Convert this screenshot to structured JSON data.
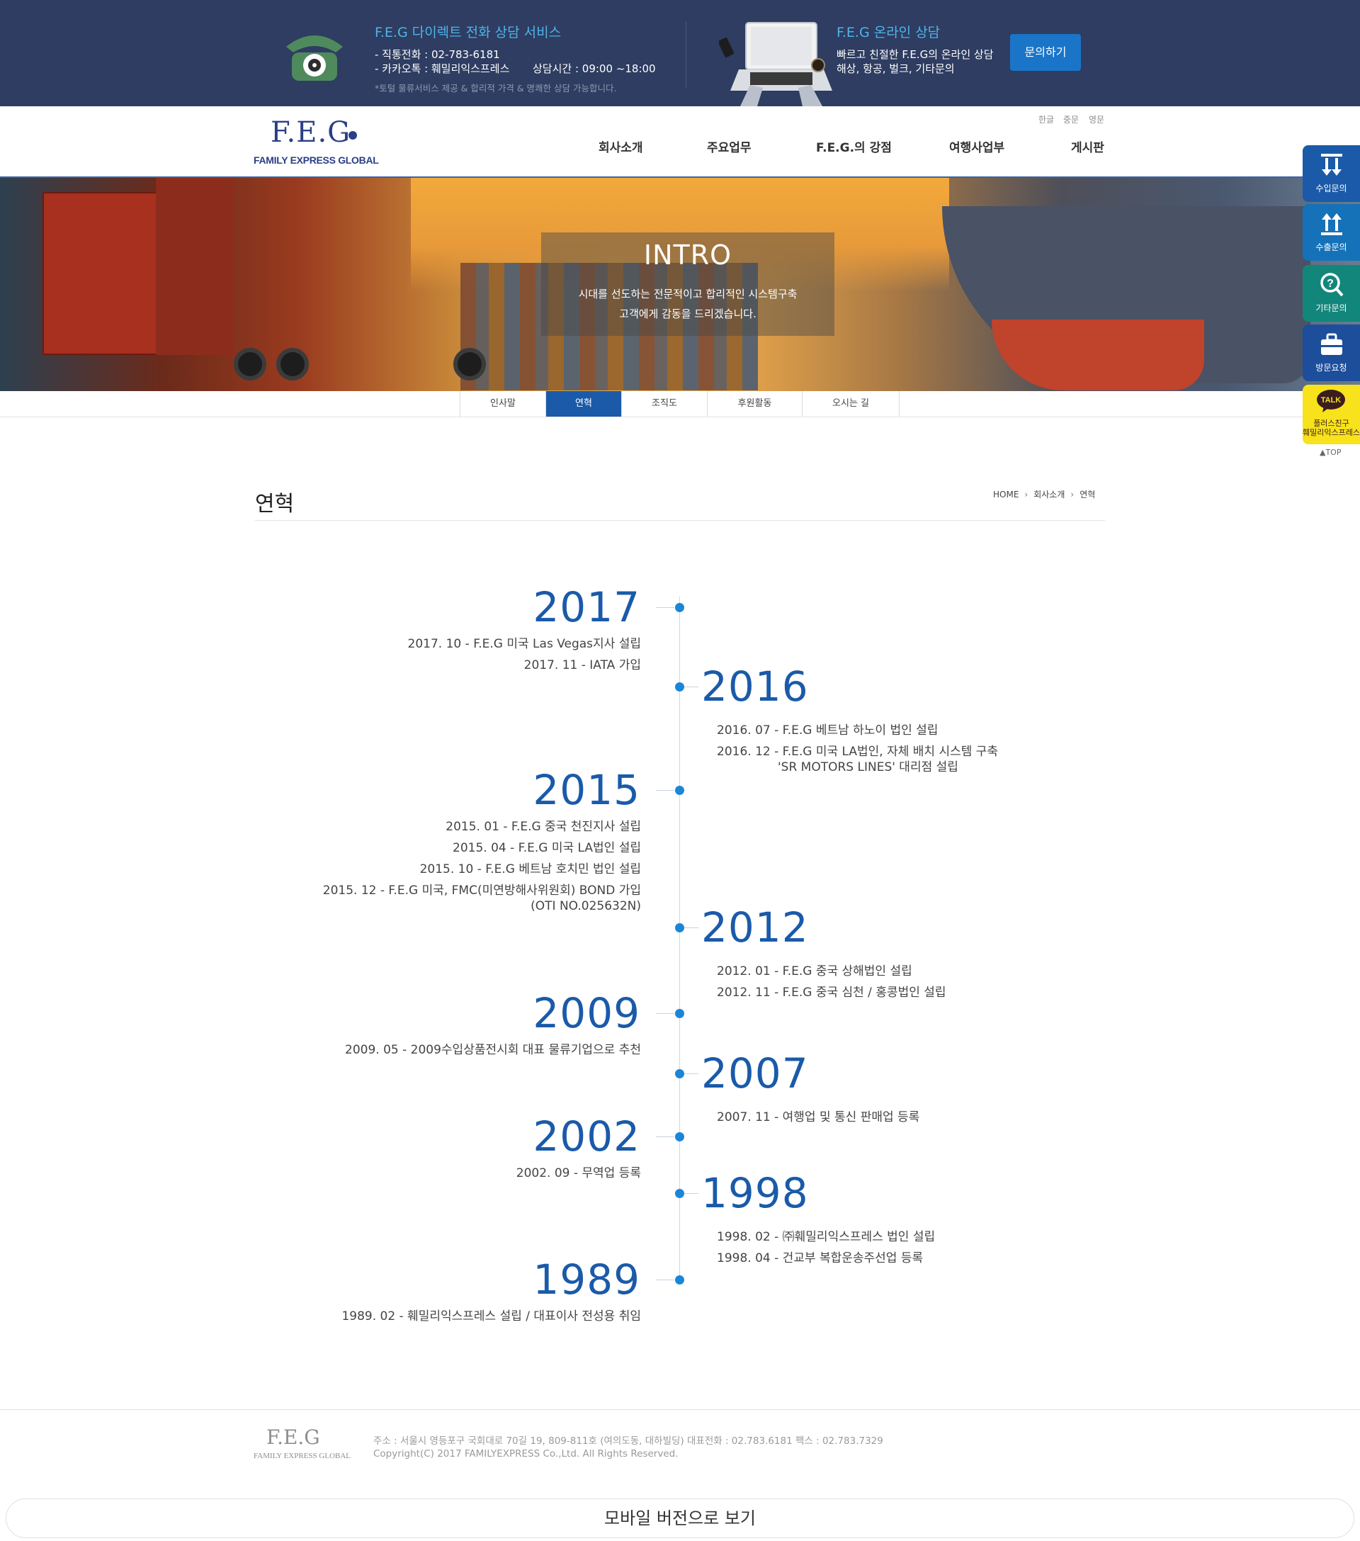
{
  "topbar": {
    "phone_title": "F.E.G 다이렉트 전화 상담 서비스",
    "phone_line1": "- 직통전화 : 02-783-6181",
    "phone_line2": "- 카카오톡 : 훼밀리익스프레스",
    "phone_hours": "상담시간 : 09:00 ~18:00",
    "phone_note": "*토털 물류서비스 제공 & 합리적 가격 & 명쾌한 상담 가능합니다.",
    "online_title": "F.E.G 온라인 상담",
    "online_line1": "빠르고 친절한 F.E.G의 온라인 상담",
    "online_line2": "해상, 항공, 벌크, 기타문의",
    "ask_button": "문의하기"
  },
  "header": {
    "logo_text": "F.E.G",
    "logo_sub": "FAMILY EXPRESS GLOBAL",
    "languages": [
      "한글",
      "중문",
      "영문"
    ],
    "nav": [
      "회사소개",
      "주요업무",
      "F.E.G.의 강점",
      "여행사업부",
      "게시판"
    ]
  },
  "hero": {
    "title": "INTRO",
    "line1": "시대를 선도하는 전문적이고 합리적인 시스템구축",
    "line2": "고객에게 감동을 드리겠습니다."
  },
  "subnav": {
    "items": [
      "인사말",
      "연혁",
      "조직도",
      "후원활동",
      "오시는 길"
    ],
    "active": "연혁"
  },
  "page": {
    "title": "연혁",
    "breadcrumb": [
      "HOME",
      "회사소개",
      "연혁"
    ]
  },
  "timeline": [
    {
      "year": "2017",
      "side": "left",
      "events": [
        "2017. 10 - F.E.G 미국 Las Vegas지사 설립",
        "2017. 11 - IATA 가입"
      ]
    },
    {
      "year": "2016",
      "side": "right",
      "events": [
        "2016. 07 - F.E.G 베트남 하노이 법인 설립",
        "2016. 12 - F.E.G 미국 LA법인, 자체 배치 시스템 구축",
        "'SR MOTORS LINES' 대리점 설립"
      ]
    },
    {
      "year": "2015",
      "side": "left",
      "events": [
        "2015. 01 - F.E.G 중국 천진지사 설립",
        "2015. 04 - F.E.G 미국 LA법인 설립",
        "2015. 10 - F.E.G 베트남 호치민 법인 설립",
        "2015. 12 - F.E.G 미국, FMC(미연방해사위원회) BOND 가입",
        "(OTI NO.025632N)"
      ]
    },
    {
      "year": "2012",
      "side": "right",
      "events": [
        "2012. 01 - F.E.G 중국 상해법인 설립",
        "2012. 11 - F.E.G 중국 심천 / 홍콩법인 설립"
      ]
    },
    {
      "year": "2009",
      "side": "left",
      "events": [
        "2009. 05 - 2009수입상품전시회 대표 물류기업으로 추천"
      ]
    },
    {
      "year": "2007",
      "side": "right",
      "events": [
        "2007. 11 - 여행업 및 통신 판매업 등록"
      ]
    },
    {
      "year": "2002",
      "side": "left",
      "events": [
        "2002. 09 - 무역업 등록"
      ]
    },
    {
      "year": "1998",
      "side": "right",
      "events": [
        "1998. 02 - ㈜훼밀리익스프레스 법인 설립",
        "1998. 04 - 건교부 복합운송주선업 등록"
      ]
    },
    {
      "year": "1989",
      "side": "left",
      "events": [
        "1989. 02 - 훼밀리익스프레스 설립 / 대표이사 전성용 취임"
      ]
    }
  ],
  "footer": {
    "logo_text": "F.E.G",
    "logo_sub": "FAMILY EXPRESS GLOBAL",
    "address": "주소 : 서울시 영등포구 국회대로 70길 19, 809-811호 (여의도동, 대하빌딩)   대표전화 : 02.783.6181   팩스 : 02.783.7329",
    "copyright": "Copyright(C) 2017 FAMILYEXPRESS Co.,Ltd. All Rights Reserved.",
    "mobile_button": "모바일 버전으로 보기"
  },
  "quick_menu": {
    "items": [
      {
        "label": "수입문의",
        "icon": "import-arrows-icon",
        "color": "#1a5aa9"
      },
      {
        "label": "수출문의",
        "icon": "export-arrows-icon",
        "color": "#1572b8"
      },
      {
        "label": "기타문의",
        "icon": "question-search-icon",
        "color": "#13867b"
      },
      {
        "label": "방문요청",
        "icon": "briefcase-icon",
        "color": "#1d4e9c"
      }
    ],
    "talk_badge": "TALK",
    "talk_line1": "플러스친구",
    "talk_line2": "훼밀리익스프레스",
    "top_label": "▲TOP"
  },
  "colors": {
    "topbar_bg": "#2e3d61",
    "accent_blue": "#1a5aa9",
    "timeline_dot": "#1a86d6",
    "kakao_yellow": "#f7e21c"
  }
}
